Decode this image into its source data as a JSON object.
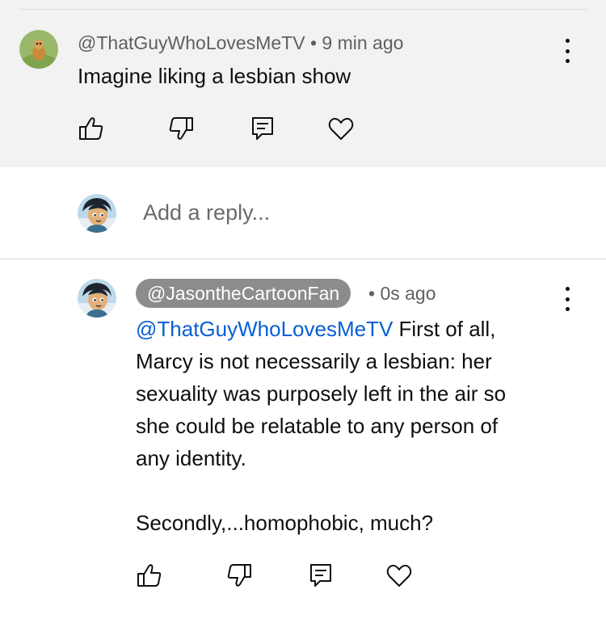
{
  "top_comment": {
    "handle": "@ThatGuyWhoLovesMeTV",
    "time": "9 min ago",
    "text": "Imagine liking a lesbian show"
  },
  "reply_box": {
    "placeholder": "Add a reply..."
  },
  "reply": {
    "handle": "@JasontheCartoonFan",
    "time": "0s ago",
    "mention": "@ThatGuyWhoLovesMeTV",
    "line1": " First of all,",
    "line2": "Marcy is not necessarily a lesbian: her",
    "line3": "sexuality was purposely left in the air so",
    "line4": "she could be relatable to any person of",
    "line5": "any identity.",
    "line6": "Secondly,...homophobic, much?"
  },
  "icons": [
    "like-icon",
    "dislike-icon",
    "reply-icon",
    "heart-icon",
    "more-options-icon"
  ],
  "colors": {
    "mention": "#065fd4",
    "highlight_bg": "#f2f2f2",
    "handle_pill": "#8c8c8c"
  }
}
